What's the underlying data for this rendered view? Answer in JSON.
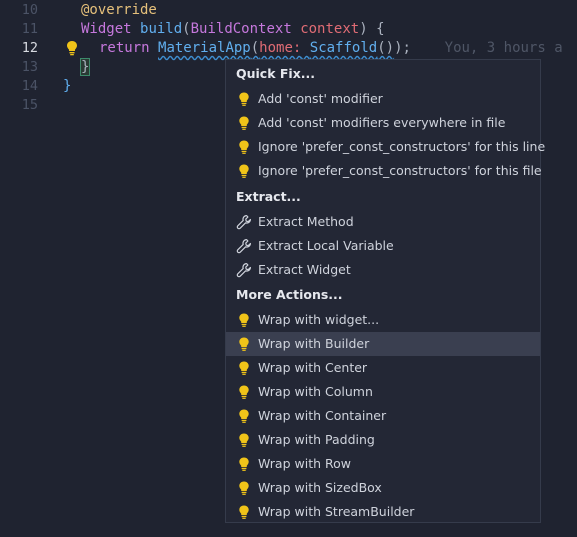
{
  "editor": {
    "lines": [
      {
        "num": "10",
        "active": false
      },
      {
        "num": "11",
        "active": false
      },
      {
        "num": "12",
        "active": true
      },
      {
        "num": "13",
        "active": false
      },
      {
        "num": "14",
        "active": false
      },
      {
        "num": "15",
        "active": false
      }
    ],
    "code": {
      "l10": {
        "decorator": "@override"
      },
      "l11": {
        "type": "Widget",
        "fn": "build",
        "param_type": "BuildContext",
        "param": "context",
        "tail": ") {"
      },
      "l12": {
        "kw": "return",
        "fn": "MaterialApp",
        "open": "(",
        "named": "home:",
        "inner": "Scaffold",
        "inner_call": "()",
        "close": ");",
        "blame": "You, 3 hours a"
      },
      "l13": {
        "brace": "}"
      },
      "l14": {
        "brace": "}"
      }
    },
    "colors": {
      "background": "#1f2330",
      "keyword": "#c678dd",
      "function": "#61afef",
      "decorator": "#e5c07b"
    }
  },
  "popup": {
    "sections": [
      {
        "title": "Quick Fix...",
        "items": [
          {
            "label": "Add 'const' modifier",
            "icon": "lightbulb-icon"
          },
          {
            "label": "Add 'const' modifiers everywhere in file",
            "icon": "lightbulb-icon"
          },
          {
            "label": "Ignore 'prefer_const_constructors' for this line",
            "icon": "lightbulb-icon"
          },
          {
            "label": "Ignore 'prefer_const_constructors' for this file",
            "icon": "lightbulb-icon"
          }
        ]
      },
      {
        "title": "Extract...",
        "items": [
          {
            "label": "Extract Method",
            "icon": "wrench-icon"
          },
          {
            "label": "Extract Local Variable",
            "icon": "wrench-icon"
          },
          {
            "label": "Extract Widget",
            "icon": "wrench-icon"
          }
        ]
      },
      {
        "title": "More Actions...",
        "items": [
          {
            "label": "Wrap with widget...",
            "icon": "lightbulb-icon"
          },
          {
            "label": "Wrap with Builder",
            "icon": "lightbulb-icon",
            "selected": true
          },
          {
            "label": "Wrap with Center",
            "icon": "lightbulb-icon"
          },
          {
            "label": "Wrap with Column",
            "icon": "lightbulb-icon"
          },
          {
            "label": "Wrap with Container",
            "icon": "lightbulb-icon"
          },
          {
            "label": "Wrap with Padding",
            "icon": "lightbulb-icon"
          },
          {
            "label": "Wrap with Row",
            "icon": "lightbulb-icon"
          },
          {
            "label": "Wrap with SizedBox",
            "icon": "lightbulb-icon"
          },
          {
            "label": "Wrap with StreamBuilder",
            "icon": "lightbulb-icon"
          }
        ]
      }
    ],
    "colors": {
      "lightbulb": "#f0c419",
      "selected_bg": "#3a3f50"
    }
  }
}
